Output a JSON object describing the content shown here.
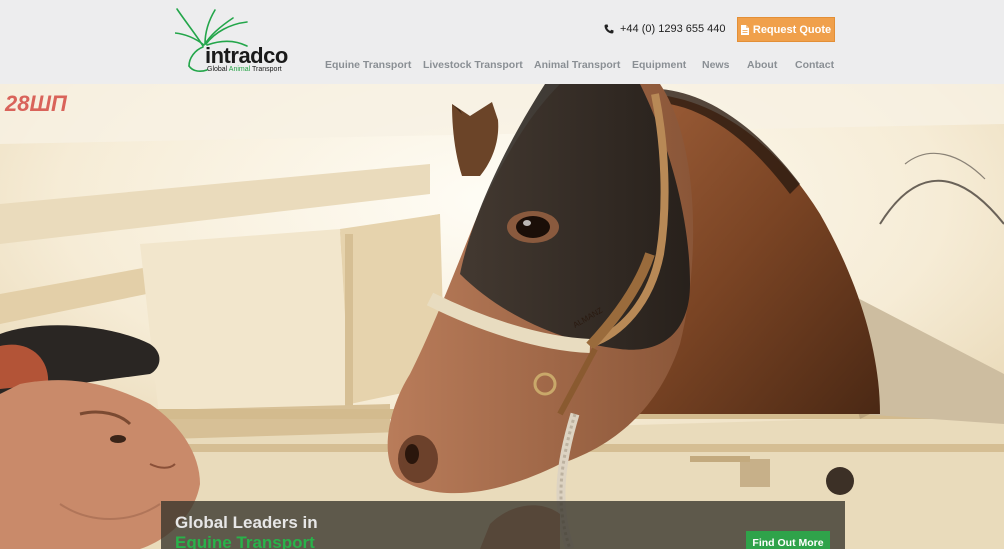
{
  "logo": {
    "word": "intradco",
    "tag_part1": "Global ",
    "tag_part2": "Animal",
    "tag_part3": " Transport"
  },
  "header": {
    "phone": "+44 (0) 1293 655 440",
    "quote_button": "Request Quote"
  },
  "nav": {
    "items": [
      {
        "label": "Equine Transport"
      },
      {
        "label": "Livestock Transport"
      },
      {
        "label": "Animal Transport"
      },
      {
        "label": "Equipment"
      },
      {
        "label": "News"
      },
      {
        "label": "About"
      },
      {
        "label": "Contact"
      }
    ]
  },
  "hero": {
    "crate_marking": "28ШП",
    "halter_tag": "ALMANZ",
    "caption_line1": "Global Leaders in",
    "caption_line2": "Equine Transport",
    "cta": "Find Out More"
  },
  "colors": {
    "accent_orange": "#f0a04b",
    "brand_green": "#29b24a",
    "nav_gray": "#8a8f94"
  }
}
